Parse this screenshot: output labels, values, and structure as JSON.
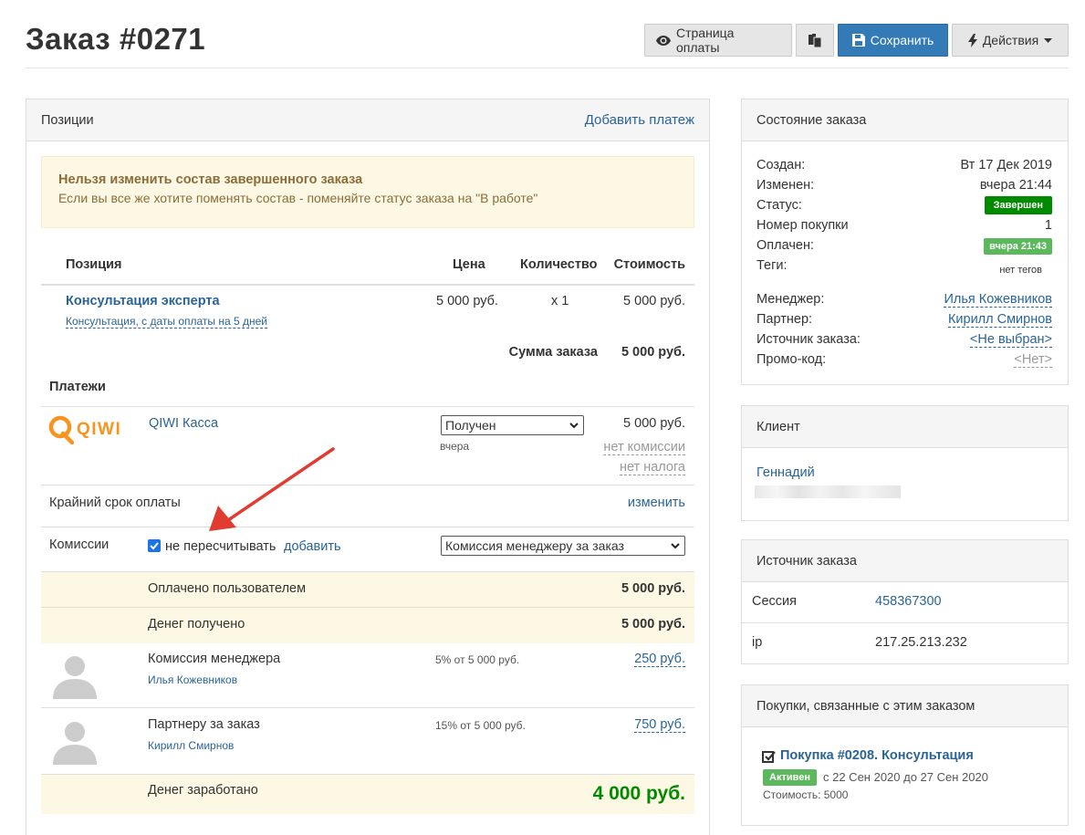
{
  "header": {
    "title": "Заказ #0271",
    "buttons": {
      "payment_page": "Страница оплаты",
      "save": "Сохранить",
      "actions": "Действия"
    }
  },
  "positions_panel": {
    "title": "Позиции",
    "add_payment": "Добавить платеж",
    "warning": {
      "title": "Нельзя изменить состав завершенного заказа",
      "text": "Если вы все же хотите поменять состав - поменяйте статус заказа на \"В работе\""
    },
    "table": {
      "headers": {
        "position": "Позиция",
        "price": "Цена",
        "qty": "Количество",
        "cost": "Стоимость"
      },
      "item": {
        "name": "Консультация эксперта",
        "subtitle": "Консультация, с даты оплаты на 5 дней",
        "price": "5 000 руб.",
        "qty": "x 1",
        "cost": "5 000 руб."
      },
      "total_label": "Сумма заказа",
      "total_value": "5 000 руб."
    },
    "payments": {
      "title": "Платежи",
      "logo_text": "QIWI",
      "name": "QIWI Касса",
      "status": "Получен",
      "date": "вчера",
      "amount": "5 000 руб.",
      "commission": "нет комиссии",
      "tax": "нет налога"
    },
    "deadline": {
      "label": "Крайний срок оплаты",
      "action": "изменить"
    },
    "commissions": {
      "label": "Комиссии",
      "checkbox_label": "не пересчитывать",
      "add": "добавить",
      "select": "Комиссия менеджеру за заказ"
    },
    "paid_by_user": {
      "label": "Оплачено пользователем",
      "value": "5 000 руб."
    },
    "money_received": {
      "label": "Денег получено",
      "value": "5 000 руб."
    },
    "manager_commission": {
      "label": "Комиссия менеджера",
      "person": "Илья Кожевников",
      "formula": "5% от 5 000 руб.",
      "value": "250 руб."
    },
    "partner_commission": {
      "label": "Партнеру за заказ",
      "person": "Кирилл Смирнов",
      "formula": "15% от 5 000 руб.",
      "value": "750 руб."
    },
    "earned": {
      "label": "Денег заработано",
      "value": "4 000 руб."
    }
  },
  "order_state": {
    "title": "Состояние заказа",
    "created_label": "Создан:",
    "created": "Вт 17 Дек 2019",
    "changed_label": "Изменен:",
    "changed": "вчера 21:44",
    "status_label": "Статус:",
    "status": "Завершен",
    "purchase_no_label": "Номер покупки",
    "purchase_no": "1",
    "paid_label": "Оплачен:",
    "paid": "вчера 21:43",
    "tags_label": "Теги:",
    "tags": "нет тегов",
    "manager_label": "Менеджер:",
    "manager": "Илья Кожевников",
    "partner_label": "Партнер:",
    "partner": "Кирилл Смирнов",
    "source_label": "Источник заказа:",
    "source": "<Не выбран>",
    "promo_label": "Промо-код:",
    "promo": "<Нет>"
  },
  "client": {
    "title": "Клиент",
    "name": "Геннадий"
  },
  "order_source": {
    "title": "Источник заказа",
    "session_label": "Сессия",
    "session": "458367300",
    "ip_label": "ip",
    "ip": "217.25.213.232"
  },
  "related": {
    "title": "Покупки, связанные с этим заказом",
    "item": "Покупка #0208. Консультация",
    "status": "Активен",
    "period": "с 22 Сен 2020 до 27 Сен 2020",
    "cost": "Стоимость: 5000"
  },
  "colors": {
    "primary": "#337ab7",
    "success": "#008a00",
    "success_light": "#5cb85c",
    "warning_bg": "#fcf8e3",
    "arrow": "#e03c31"
  }
}
